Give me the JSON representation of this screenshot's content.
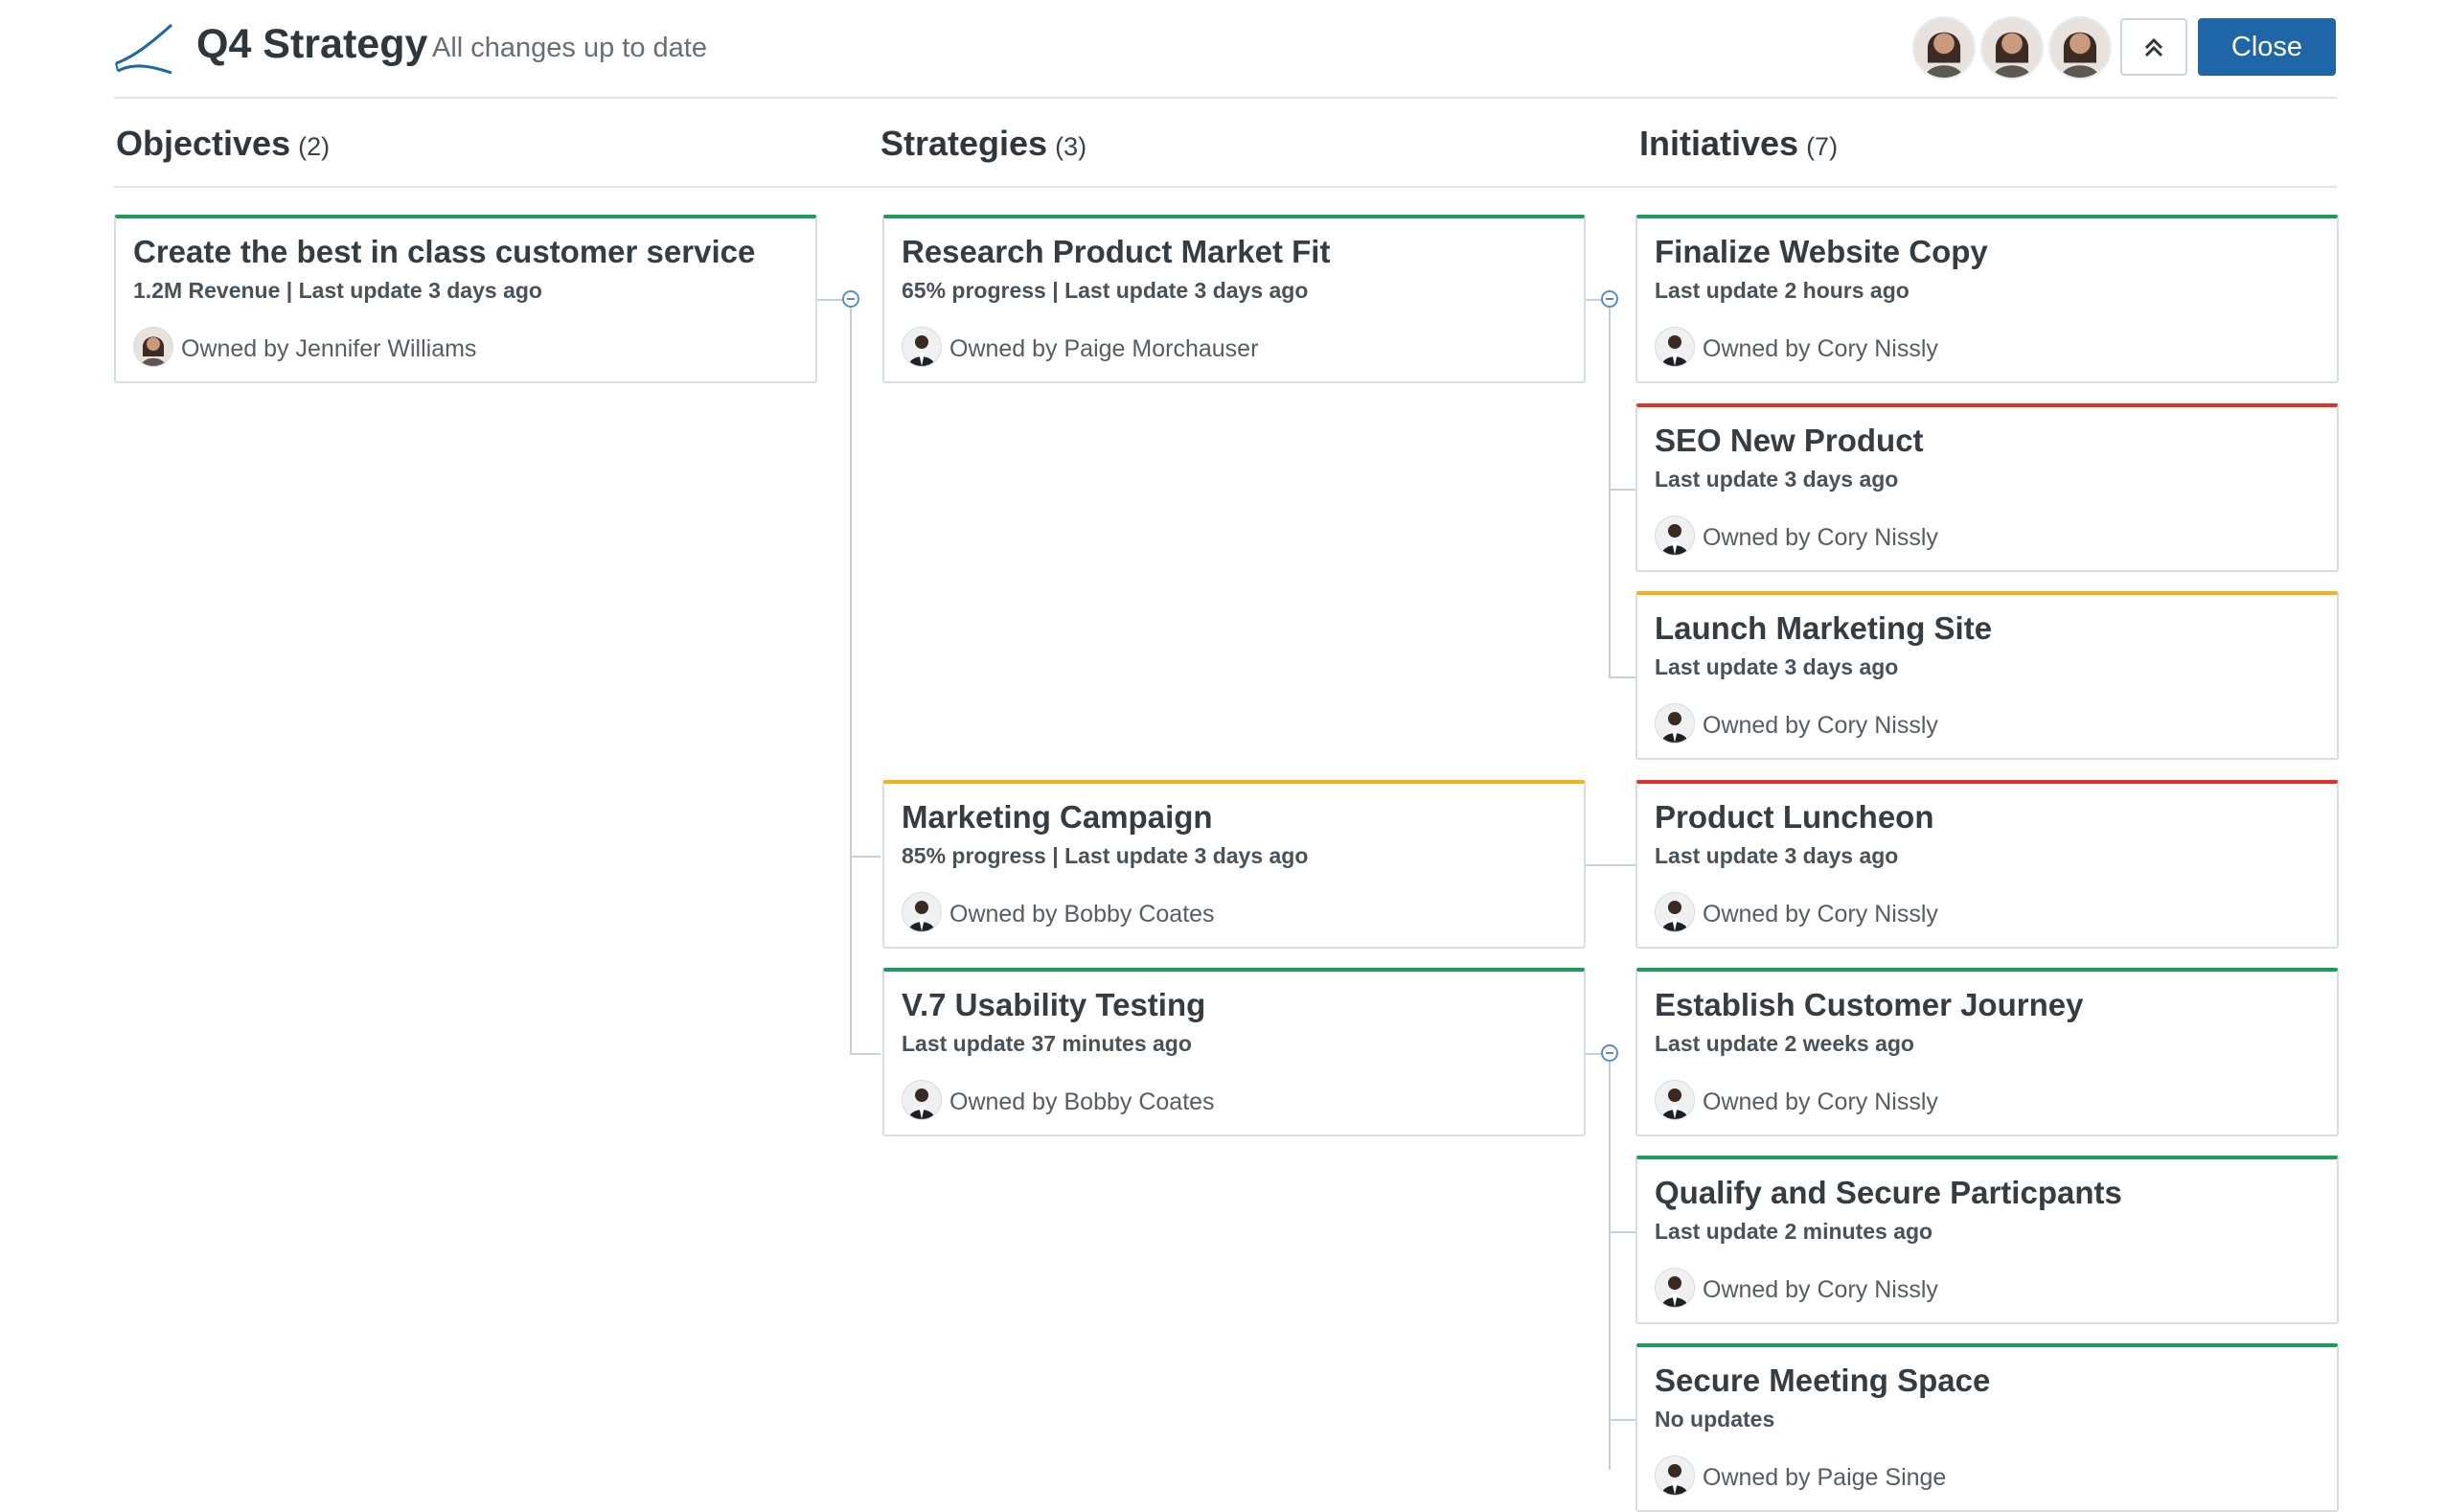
{
  "header": {
    "title": "Q4 Strategy",
    "status": "All changes up to date",
    "close_label": "Close"
  },
  "columns": [
    {
      "label": "Objectives",
      "count": "(2)"
    },
    {
      "label": "Strategies",
      "count": "(3)"
    },
    {
      "label": "Initiatives",
      "count": "(7)"
    }
  ],
  "objectives": [
    {
      "title": "Create the best in class customer service",
      "meta": "1.2M Revenue | Last update 3 days ago",
      "owner": "Owned by Jennifer Williams",
      "status_color": "#1f9b5a"
    }
  ],
  "strategies": [
    {
      "title": "Research Product Market Fit",
      "meta": "65% progress | Last update 3 days ago",
      "owner": "Owned by Paige Morchauser",
      "status_color": "#1f9b5a"
    },
    {
      "title": "Marketing Campaign",
      "meta": "85% progress | Last update 3 days ago",
      "owner": "Owned by Bobby Coates",
      "status_color": "#f1b21b"
    },
    {
      "title": "V.7 Usability Testing",
      "meta": "Last update 37 minutes ago",
      "owner": "Owned by Bobby Coates",
      "status_color": "#1f9b5a"
    }
  ],
  "initiatives": [
    {
      "title": "Finalize Website Copy",
      "meta": "Last update 2 hours ago",
      "owner": "Owned by Cory Nissly",
      "status_color": "#1f9b5a"
    },
    {
      "title": "SEO New Product",
      "meta": "Last update 3 days ago",
      "owner": "Owned by Cory Nissly",
      "status_color": "#e0322c"
    },
    {
      "title": "Launch Marketing Site",
      "meta": "Last update 3 days ago",
      "owner": "Owned by Cory Nissly",
      "status_color": "#f1b21b"
    },
    {
      "title": "Product Luncheon",
      "meta": "Last update 3 days ago",
      "owner": "Owned by Cory Nissly",
      "status_color": "#e0322c"
    },
    {
      "title": "Establish Customer Journey",
      "meta": "Last update 2 weeks ago",
      "owner": "Owned by Cory Nissly",
      "status_color": "#1f9b5a"
    },
    {
      "title": "Qualify and Secure Particpants",
      "meta": "Last update 2 minutes ago",
      "owner": "Owned by Cory Nissly",
      "status_color": "#1f9b5a"
    },
    {
      "title": "Secure Meeting Space",
      "meta": "No updates",
      "owner": "Owned by Paige Singe",
      "status_color": "#1f9b5a"
    }
  ],
  "colors": {
    "accent": "#1f66a8",
    "on_track": "#1f9b5a",
    "at_risk": "#f1b21b",
    "off_track": "#e0322c"
  }
}
